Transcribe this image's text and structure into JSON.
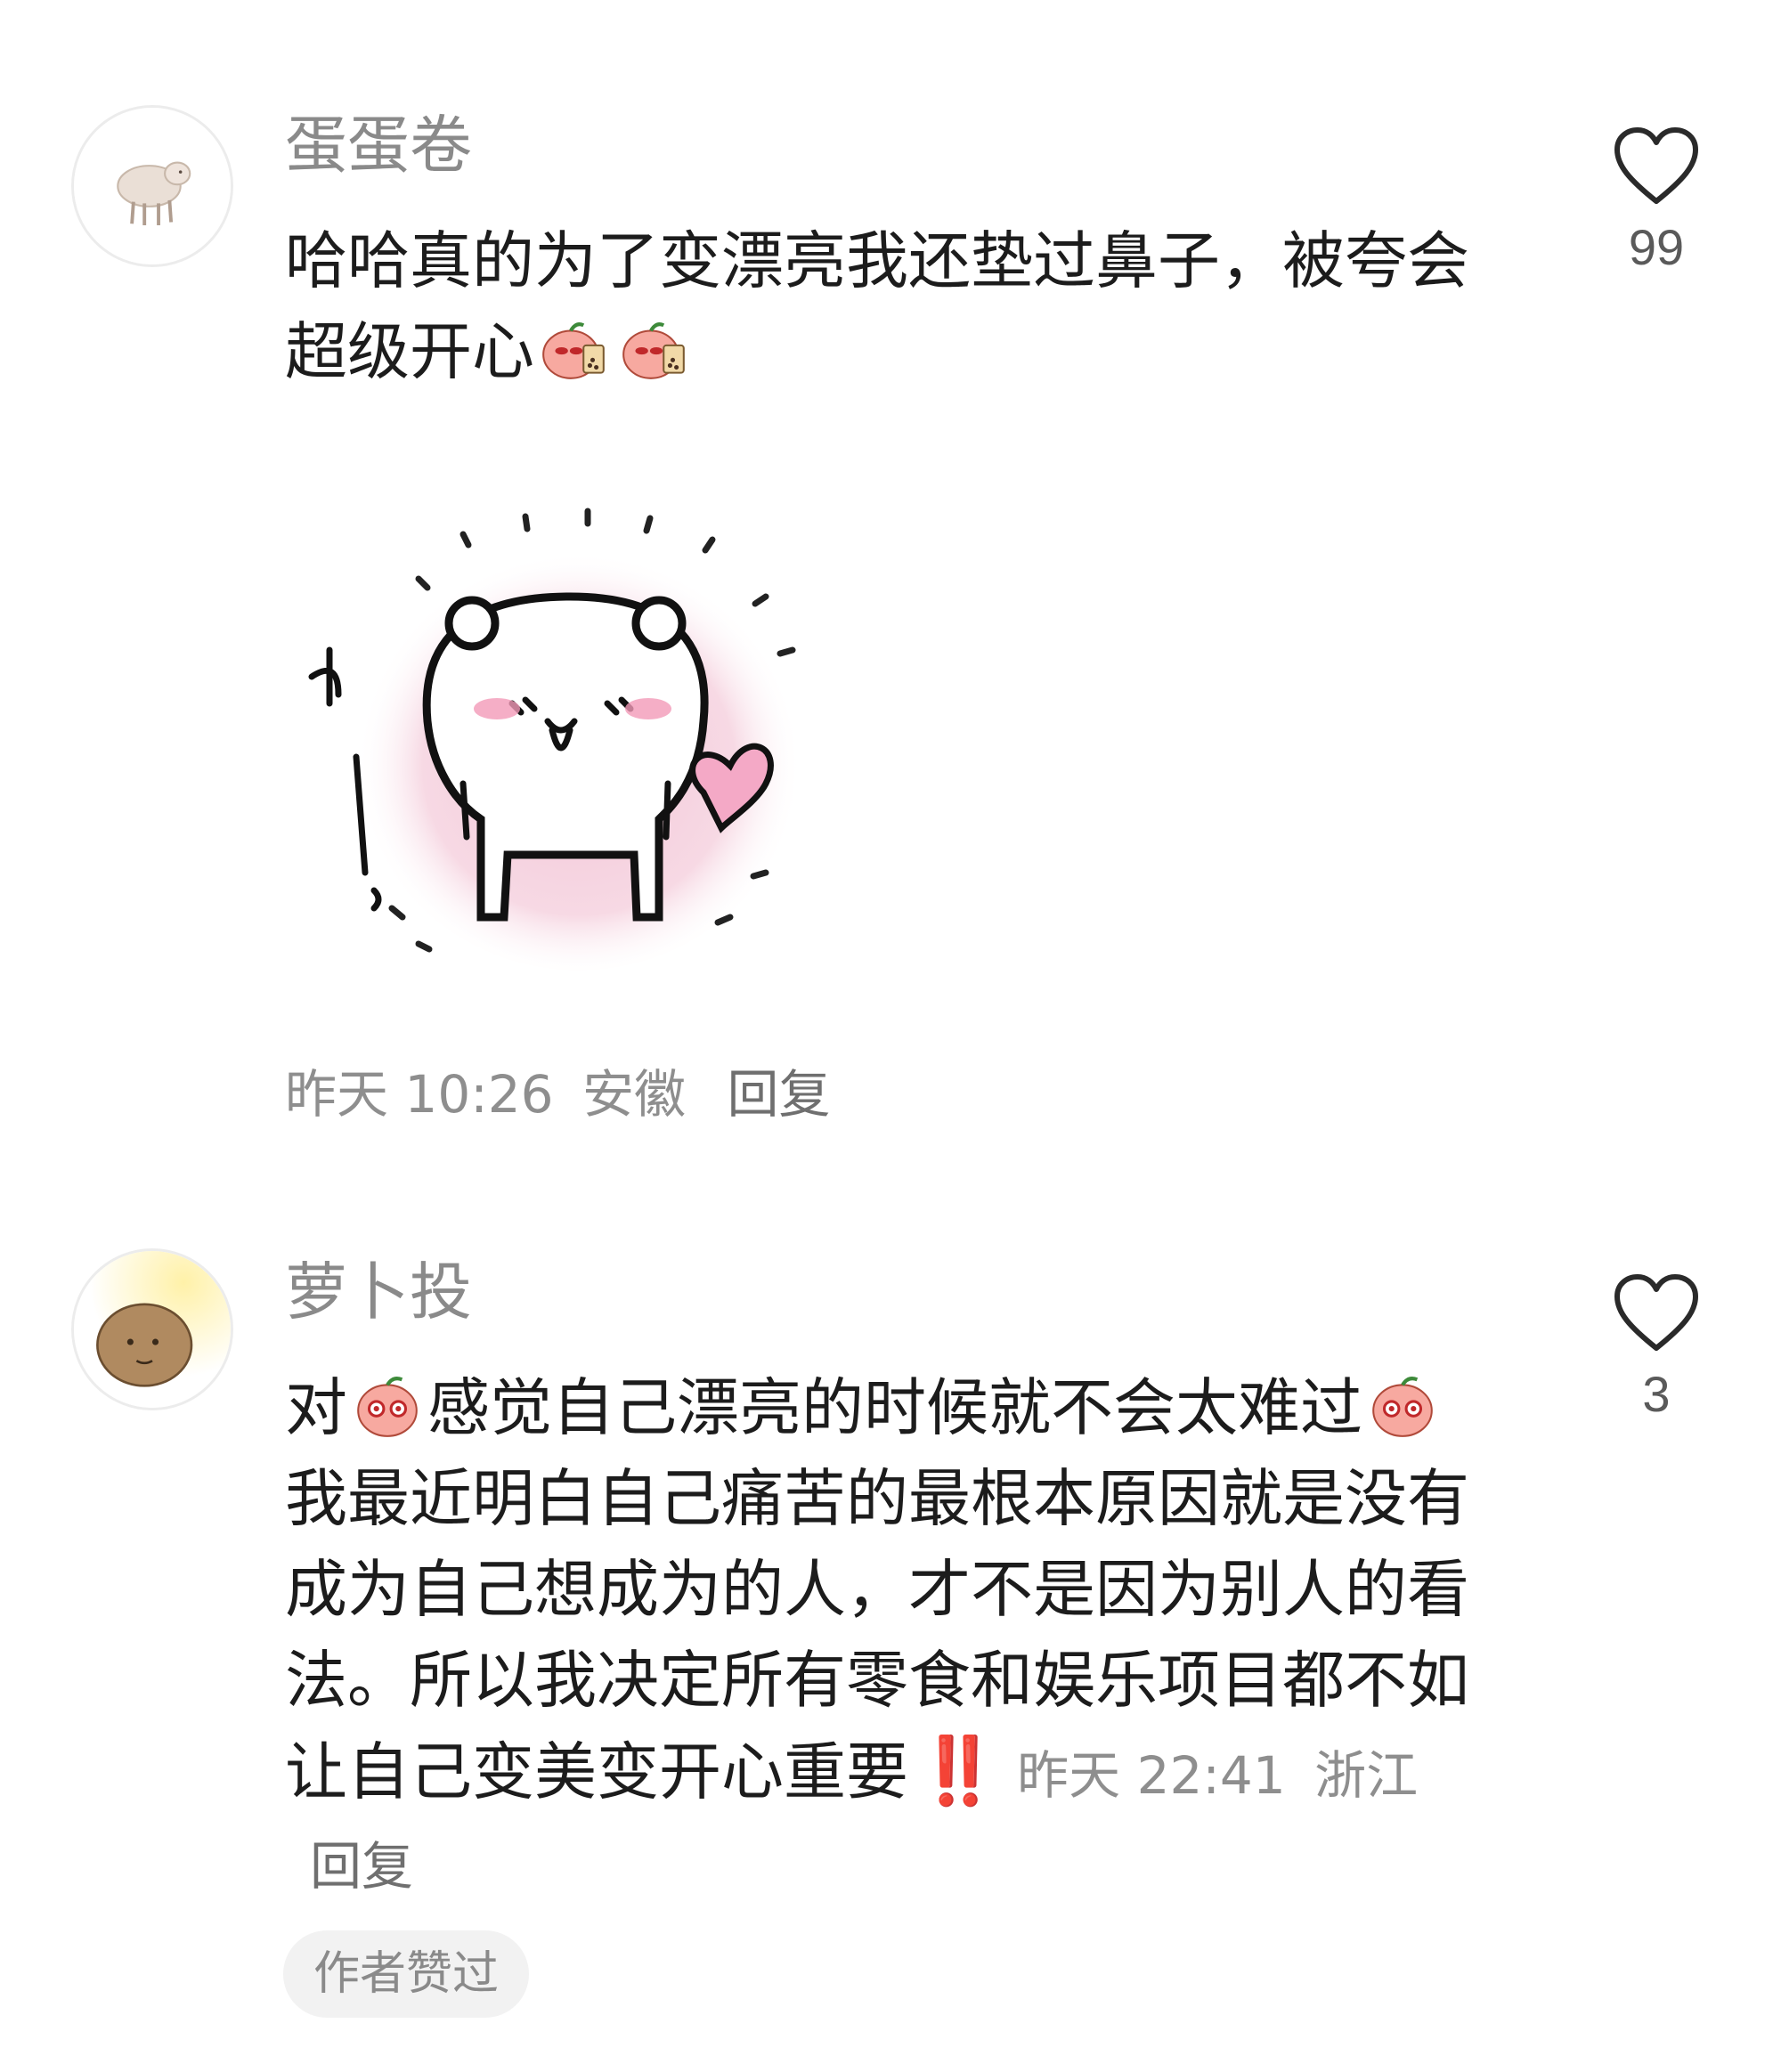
{
  "comments": [
    {
      "username": "蛋蛋卷",
      "text_a": "哈哈真的为了变漂亮我还垫过鼻子，被夸会超级开心",
      "emoji": "peach-bubble-tea-emoji",
      "sticker": "bear-waving-heart-sticker",
      "meta": {
        "time": "昨天 10:26",
        "location": "安徽",
        "reply": "回复"
      },
      "likes": "99"
    },
    {
      "username": "萝卜投",
      "text_a": "对",
      "text_b": "感觉自己漂亮的时候就不会太难过",
      "text_c": "我最近明白自己痛苦的最根本原因就是没有成为自己想成为的人，才不是因为别人的看法。所以我决定所有零食和娱乐项目都不如让自己变美变开心重要",
      "emoji": "peach-crying-emoji",
      "exclamation": "‼️",
      "meta": {
        "time": "昨天 22:41",
        "location": "浙江",
        "reply": "回复"
      },
      "likes": "3",
      "badge": "作者赞过"
    }
  ],
  "colors": {
    "username": "#8a8a8a",
    "meta": "#8e8e8e",
    "badge_bg": "#f2f2f2",
    "exclamation": "#e0232a",
    "sticker_glow": "#efb8cf"
  },
  "icons": [
    "heart-outline-icon",
    "sheep-avatar-icon",
    "potato-avatar-icon"
  ]
}
